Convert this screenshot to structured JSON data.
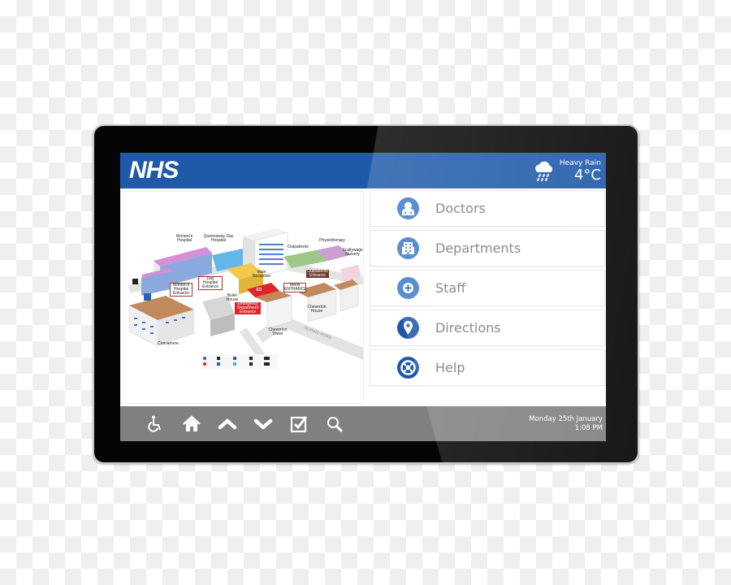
{
  "header": {
    "logo": "NHS",
    "weather": {
      "icon": "heavy-rain-cloud-icon",
      "condition": "Heavy Rain",
      "temperature": "4°C"
    }
  },
  "map": {
    "labels": {
      "womens_hospital": "Women's Hospital",
      "queensway": "Queensway Day Hospital",
      "physiotherapy": "Physiotherapy",
      "outpatients": "Outpatients",
      "scallywags": "Scallywags Nursery",
      "main_reception": "Main Reception",
      "main_entrance": "MAIN ENTRANCE",
      "outpatients_entrance": "Outpatients Entrance",
      "day_hospital_entrance": "Day Hospital Entrance",
      "womens_entrance": "Women's Hospital Entrance",
      "emergency_entrance": "Emergency Department Entrance",
      "boiler_house": "Boiler House",
      "convamore": "Convamore",
      "cheverton_tower": "Cheverton Tower",
      "cheverton_house": "Cheverton House",
      "road": "ROPING ROAD",
      "ed": "ED"
    }
  },
  "menu": {
    "items": [
      {
        "label": "Doctors",
        "icon": "doctor-icon"
      },
      {
        "label": "Departments",
        "icon": "hospital-building-icon"
      },
      {
        "label": "Staff",
        "icon": "medical-cross-icon"
      },
      {
        "label": "Directions",
        "icon": "map-pin-icon"
      },
      {
        "label": "Help",
        "icon": "lifebuoy-icon"
      }
    ]
  },
  "footer": {
    "buttons": [
      {
        "icon": "wheelchair-icon",
        "label": "Accessibility"
      },
      {
        "icon": "home-icon",
        "label": "Home"
      },
      {
        "icon": "chevron-up-icon",
        "label": "Up"
      },
      {
        "icon": "chevron-down-icon",
        "label": "Down"
      },
      {
        "icon": "checkbox-icon",
        "label": "Select"
      },
      {
        "icon": "search-icon",
        "label": "Search"
      }
    ],
    "date": "Monday 25th January",
    "time": "1:08 PM"
  },
  "colors": {
    "nhs_blue": "#1f5aa8",
    "icon_blue": "#3f7ac9",
    "footer_gray": "#808080"
  }
}
